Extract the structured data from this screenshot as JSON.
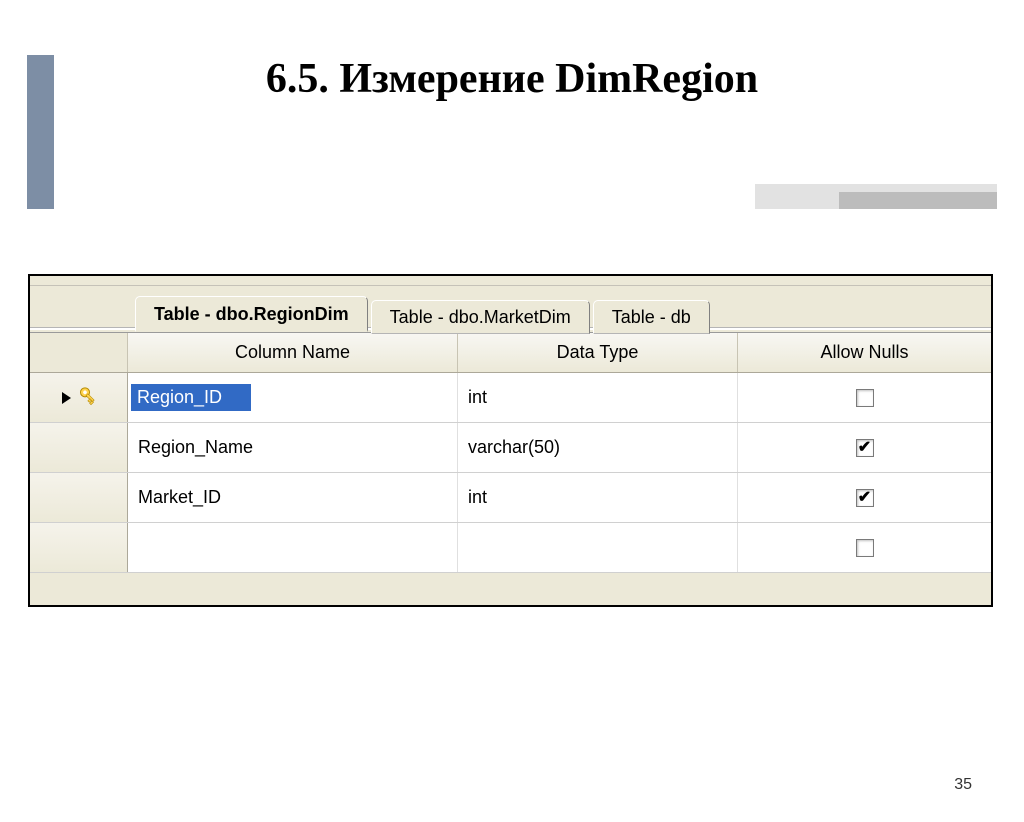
{
  "slide": {
    "title": "6.5. Измерение DimRegion",
    "page_number": "35"
  },
  "view": {
    "tabs": [
      {
        "label": "Table - dbo.RegionDim",
        "active": true
      },
      {
        "label": "Table - dbo.MarketDim",
        "active": false
      },
      {
        "label": "Table - db",
        "active": false
      }
    ],
    "headers": {
      "column_name": "Column Name",
      "data_type": "Data Type",
      "allow_nulls": "Allow Nulls"
    },
    "rows": [
      {
        "column_name": "Region_ID",
        "data_type": "int",
        "allow_nulls": false,
        "selected": true,
        "primary_key": true
      },
      {
        "column_name": "Region_Name",
        "data_type": "varchar(50)",
        "allow_nulls": true,
        "selected": false,
        "primary_key": false
      },
      {
        "column_name": "Market_ID",
        "data_type": "int",
        "allow_nulls": true,
        "selected": false,
        "primary_key": false
      },
      {
        "column_name": "",
        "data_type": "",
        "allow_nulls": false,
        "selected": false,
        "primary_key": false
      }
    ]
  }
}
